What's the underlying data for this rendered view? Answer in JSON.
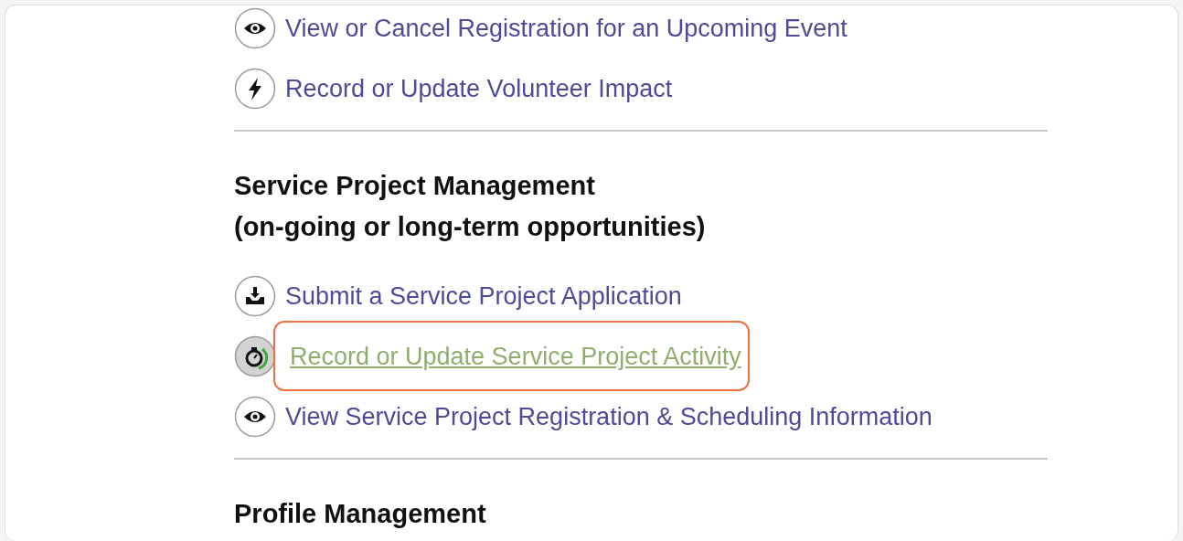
{
  "sections": [
    {
      "links": [
        {
          "kind": "eye",
          "label": "View or Cancel Registration for an Upcoming Event",
          "highlighted": false
        },
        {
          "kind": "bolt",
          "label": "Record or Update Volunteer Impact",
          "highlighted": false
        }
      ]
    },
    {
      "heading": [
        "Service Project Management",
        "(on-going or long-term opportunities)"
      ],
      "links": [
        {
          "kind": "inbox",
          "label": "Submit a Service Project Application",
          "highlighted": false
        },
        {
          "kind": "stopwatch",
          "label": "Record or Update Service Project Activity",
          "highlighted": true
        },
        {
          "kind": "eye",
          "label": "View Service Project Registration & Scheduling Information",
          "highlighted": false
        }
      ]
    },
    {
      "heading": [
        "Profile Management"
      ]
    }
  ]
}
